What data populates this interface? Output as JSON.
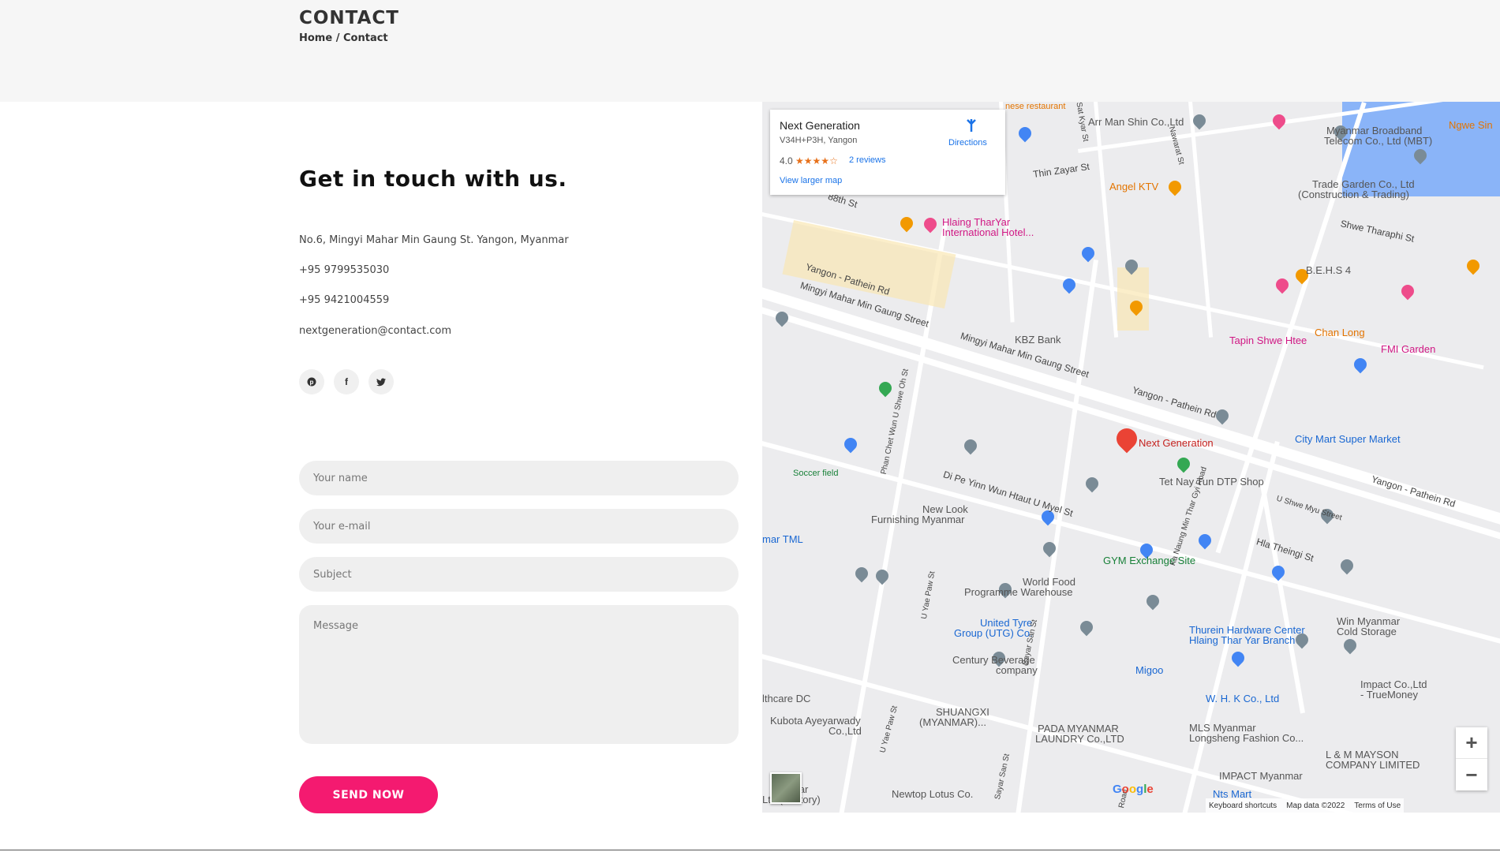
{
  "header": {
    "title": "CONTACT",
    "breadcrumb_home": "Home",
    "breadcrumb_sep": "/",
    "breadcrumb_current": "Contact"
  },
  "contact": {
    "heading": "Get in touch with us.",
    "address": "No.6, Mingyi Mahar Min Gaung St. Yangon, Myanmar",
    "phone1": "+95 9799535030",
    "phone2": "+95 9421004559",
    "email": "nextgeneration@contact.com",
    "socials": [
      {
        "icon": "pinterest-icon",
        "glyph": "℗"
      },
      {
        "icon": "facebook-icon",
        "glyph": "f"
      },
      {
        "icon": "twitter-icon",
        "glyph": "t"
      }
    ]
  },
  "form": {
    "name_placeholder": "Your name",
    "email_placeholder": "Your e-mail",
    "subject_placeholder": "Subject",
    "message_placeholder": "Message",
    "submit_label": "SEND NOW"
  },
  "map": {
    "card": {
      "title": "Next Generation",
      "address": "V34H+P3H, Yangon",
      "rating": "4.0",
      "stars": "★★★★☆",
      "reviews": "2 reviews",
      "larger_map": "View larger map",
      "directions": "Directions"
    },
    "places": {
      "next_generation": "Next Generation",
      "hlaing1": "Hlaing TharYar",
      "hlaing2": "International Hotel...",
      "angel": "Angel KTV",
      "arr_man": "Arr Man Shin Co.,Ltd",
      "mbt1": "Myanmar Broadband",
      "mbt2": "Telecom Co., Ltd (MBT)",
      "trade1": "Trade Garden Co., Ltd",
      "trade2": "(Construction & Trading)",
      "behs": "B.E.H.S 4",
      "kbz": "KBZ Bank",
      "tapin": "Tapin Shwe Htee",
      "chan_long": "Chan Long",
      "fmi": "FMI Garden",
      "city_mart": "City Mart Super Market",
      "tet_nay": "Tet Nay Tun DTP Shop",
      "new_look1": "New Look",
      "new_look2": "Furnishing Myanmar",
      "gym": "GYM Exchange Site",
      "world_food1": "World Food",
      "world_food2": "Programme Warehouse",
      "united1": "United Tyre",
      "united2": "Group (UTG) Co.",
      "century1": "Century Beverage",
      "century2": "company",
      "migoo": "Migoo",
      "thurein1": "Thurein Hardware Center",
      "thurein2": "Hlaing Thar Yar Branch",
      "win1": "Win Myanmar",
      "win2": "Cold Storage",
      "impact1": "Impact Co.,Ltd",
      "impact2": "- TrueMoney",
      "whk": "W. H. K Co., Ltd",
      "mls1": "MLS Myanmar",
      "mls2": "Longsheng Fashion Co...",
      "shuangxi1": "SHUANGXI",
      "shuangxi2": "(MYANMAR)...",
      "pada1": "PADA MYANMAR",
      "pada2": "LAUNDRY Co.,LTD",
      "kubota1": "Kubota Ayeyarwady",
      "kubota2": "Co.,Ltd",
      "healthcare": "lthcare DC",
      "lm1": "L & M MAYSON",
      "lm2": "COMPANY LIMITED",
      "impact_myanmar": "IMPACT Myanmar",
      "nts": "Nts Mart",
      "newtop": "Newtop Lotus Co.",
      "ngwe": "Ngwe Sin",
      "soccer": "Soccer field",
      "tml": "mar TML",
      "factory1": "mar",
      "factory2": "Ltd (Factory)",
      "chinese": "nese restaurant"
    },
    "streets": {
      "s88th": "88th St",
      "yangon_pathein1": "Yangon - Pathein Rd",
      "mingyi1": "Mingyi Mahar Min Gaung Street",
      "mingyi2": "Mingyi Mahar Min Gaung Street",
      "yangon_pathein2": "Yangon - Pathein Rd",
      "yangon_pathein3": "Yangon - Pathein Rd",
      "thin_zayar": "Thin Zayar St",
      "shwe_tharaphi": "Shwe Tharaphi St",
      "di_pe_yinn": "Di Pe Yinn Wun Htaut U Myel St",
      "hla_theingi": "Hla Theingi St",
      "u_shwe_myu": "U Shwe Myu Street",
      "phan_chet": "Phan Chet Wun U Shwe Oh St",
      "u_yae_paw": "U Yae Paw St",
      "u_yae_paw2": "U Yae Paw St",
      "sayar_san": "Sayar San St",
      "sayar_san2": "Sayar San St",
      "ka_naung": "Ka Naung Min Thar Gyi Road",
      "nawarat": "Nawarat St",
      "sat_kyar": "Sat Kyar St",
      "road": "Road"
    },
    "attribution": {
      "keyboard": "Keyboard shortcuts",
      "map_data": "Map data ©2022",
      "terms": "Terms of Use"
    },
    "zoom_in": "+",
    "zoom_out": "−",
    "google": [
      "G",
      "o",
      "o",
      "g",
      "l",
      "e"
    ]
  }
}
